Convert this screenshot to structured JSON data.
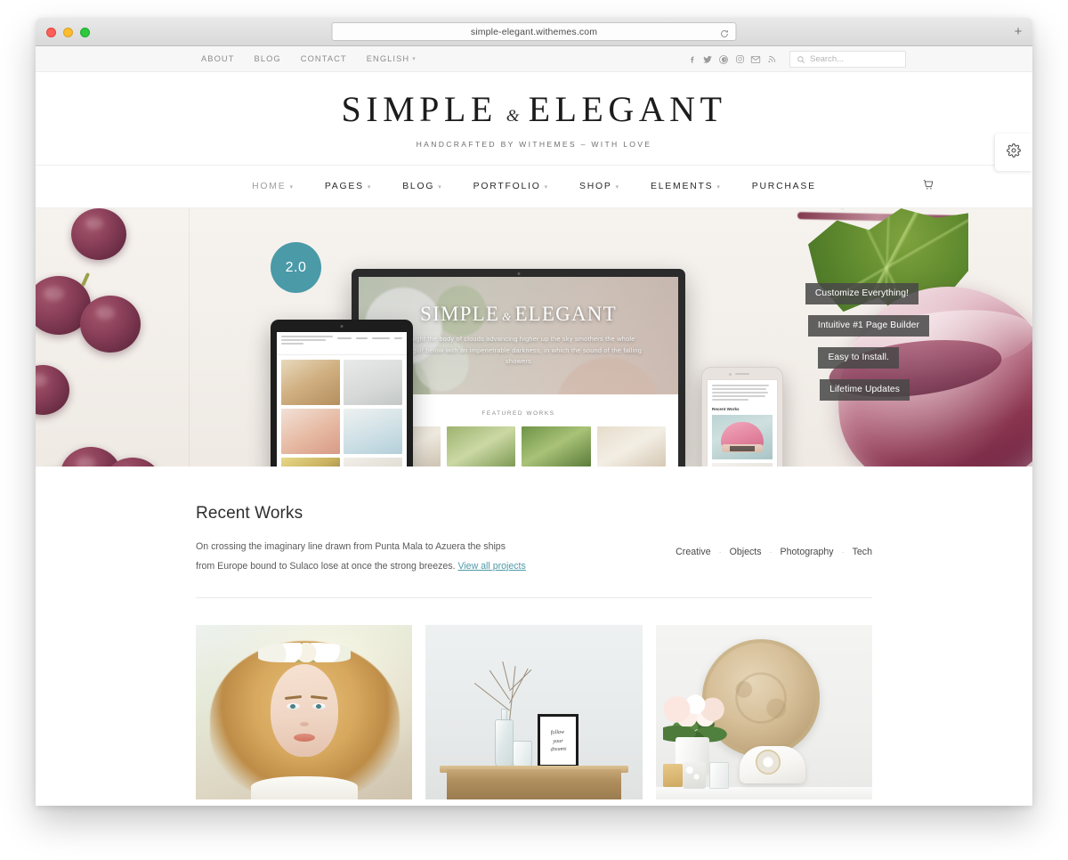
{
  "browser": {
    "url": "simple-elegant.withemes.com",
    "reload_icon": "reload-icon",
    "new_tab_label": "+"
  },
  "topbar": {
    "nav": [
      {
        "label": "ABOUT",
        "has_caret": false
      },
      {
        "label": "BLOG",
        "has_caret": false
      },
      {
        "label": "CONTACT",
        "has_caret": false
      },
      {
        "label": "ENGLISH",
        "has_caret": true
      }
    ],
    "social": [
      {
        "name": "facebook-icon"
      },
      {
        "name": "twitter-icon"
      },
      {
        "name": "pinterest-icon"
      },
      {
        "name": "instagram-icon"
      },
      {
        "name": "email-icon"
      },
      {
        "name": "rss-icon"
      }
    ],
    "search_placeholder": "Search...",
    "search_value": ""
  },
  "logo": {
    "word1": "SIMPLE",
    "amp": "&",
    "word2": "ELEGANT",
    "tagline": "HANDCRAFTED BY WITHEMES – WITH LOVE"
  },
  "mainnav": {
    "items": [
      {
        "label": "HOME",
        "has_caret": true,
        "active": true
      },
      {
        "label": "PAGES",
        "has_caret": true,
        "active": false
      },
      {
        "label": "BLOG",
        "has_caret": true,
        "active": false
      },
      {
        "label": "PORTFOLIO",
        "has_caret": true,
        "active": false
      },
      {
        "label": "SHOP",
        "has_caret": true,
        "active": false
      },
      {
        "label": "ELEMENTS",
        "has_caret": true,
        "active": false
      },
      {
        "label": "PURCHASE",
        "has_caret": false,
        "active": false
      }
    ],
    "cart_icon": "cart-icon"
  },
  "gear_tab": {
    "icon": "gear-icon"
  },
  "hero": {
    "badge": "2.0",
    "badge_color": "#4a9aa8",
    "callouts": [
      "Customize Everything!",
      "Intuitive #1 Page Builder",
      "Easy to Install.",
      "Lifetime Updates"
    ],
    "laptop": {
      "title_word1": "SIMPLE",
      "title_amp": "&",
      "title_word2": "ELEGANT",
      "subtitle": "At night the body of clouds advancing higher up the sky smothers the whole quiet gulf below with an impenetrable darkness, in which the sound of the falling showers",
      "featured_label": "FEATURED WORKS"
    },
    "phone": {
      "heading": "Recent Works"
    }
  },
  "recent_works": {
    "title": "Recent Works",
    "description": "On crossing the imaginary line drawn from Punta Mala to Azuera the ships from Europe bound to Sulaco lose at once the strong breezes. ",
    "link_label": "View all projects",
    "filters": [
      "Creative",
      "Objects",
      "Photography",
      "Tech"
    ],
    "filter_separator": "·",
    "link_color": "#4d9aa8"
  },
  "portfolio": {
    "items": [
      {
        "name": "portrait-bride-flower-crown"
      },
      {
        "name": "vase-branches-framed-print"
      },
      {
        "name": "roses-tray-vintage-phone"
      }
    ],
    "frame_text_line1": "follow",
    "frame_text_line2": "your",
    "frame_text_line3": "dreams"
  }
}
